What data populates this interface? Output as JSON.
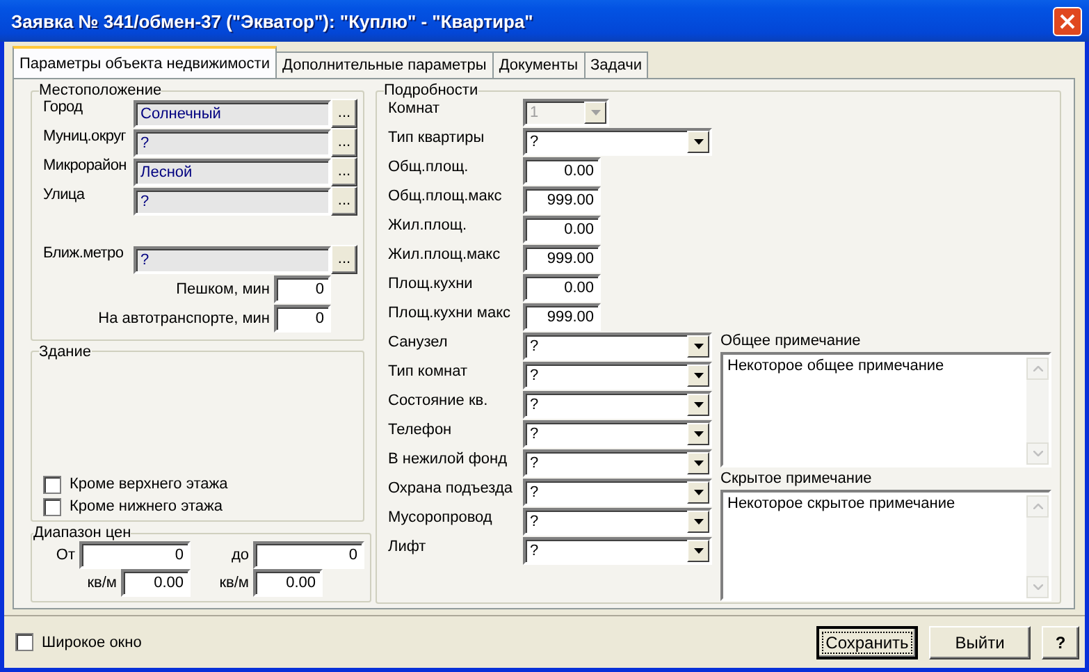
{
  "window": {
    "title": "Заявка № 341/обмен-37 (\"Экватор\"): \"Куплю\" - \"Квартира\""
  },
  "tabs": [
    {
      "label": "Параметры объекта недвижимости",
      "selected": true
    },
    {
      "label": "Дополнительные параметры",
      "selected": false
    },
    {
      "label": "Документы",
      "selected": false
    },
    {
      "label": "Задачи",
      "selected": false
    }
  ],
  "location": {
    "title": "Местоположение",
    "fields": [
      {
        "label": "Город",
        "value": "Солнечный"
      },
      {
        "label": "Муниц.округ",
        "value": "?"
      },
      {
        "label": "Микрорайон",
        "value": "Лесной"
      },
      {
        "label": "Улица",
        "value": "?"
      },
      {
        "label": "Ближ.метро",
        "value": "?"
      }
    ],
    "browse_label": "...",
    "times": [
      {
        "label": "Пешком, мин",
        "value": "0"
      },
      {
        "label": "На автотранспорте, мин",
        "value": "0"
      }
    ]
  },
  "building": {
    "title": "Здание",
    "checkboxes": [
      {
        "label": "Кроме верхнего этажа",
        "checked": false
      },
      {
        "label": "Кроме нижнего этажа",
        "checked": false
      }
    ]
  },
  "price_range": {
    "title": "Диапазон цен",
    "rows": [
      [
        {
          "label": "От",
          "value": "0"
        },
        {
          "label": "до",
          "value": "0"
        }
      ],
      [
        {
          "label": "кв/м",
          "value": "0.00"
        },
        {
          "label": "кв/м",
          "value": "0.00"
        }
      ]
    ]
  },
  "details": {
    "title": "Подробности",
    "fields": [
      {
        "label": "Комнат",
        "kind": "short_combo",
        "value": "1",
        "disabled": true
      },
      {
        "label": "Тип квартиры",
        "kind": "combo",
        "value": "?",
        "disabled": false
      },
      {
        "label": "Общ.площ.",
        "kind": "number",
        "value": "0.00",
        "disabled": false
      },
      {
        "label": "Общ.площ.макс",
        "kind": "number",
        "value": "999.00",
        "disabled": false
      },
      {
        "label": "Жил.площ.",
        "kind": "number",
        "value": "0.00",
        "disabled": false
      },
      {
        "label": "Жил.площ.макс",
        "kind": "number",
        "value": "999.00",
        "disabled": false
      },
      {
        "label": "Площ.кухни",
        "kind": "number",
        "value": "0.00",
        "disabled": false
      },
      {
        "label": "Площ.кухни макс",
        "kind": "number",
        "value": "999.00",
        "disabled": false
      },
      {
        "label": "Санузел",
        "kind": "combo",
        "value": "?",
        "disabled": false
      },
      {
        "label": "Тип комнат",
        "kind": "combo",
        "value": "?",
        "disabled": false
      },
      {
        "label": "Состояние кв.",
        "kind": "combo",
        "value": "?",
        "disabled": false
      },
      {
        "label": "Телефон",
        "kind": "combo",
        "value": "?",
        "disabled": false
      },
      {
        "label": "В нежилой фонд",
        "kind": "combo",
        "value": "?",
        "disabled": false
      },
      {
        "label": "Охрана подъезда",
        "kind": "combo",
        "value": "?",
        "disabled": false
      },
      {
        "label": "Мусоропровод",
        "kind": "combo",
        "value": "?",
        "disabled": false
      },
      {
        "label": "Лифт",
        "kind": "combo",
        "value": "?",
        "disabled": false
      }
    ],
    "notes": [
      {
        "label": "Общее примечание",
        "value": "Некоторое общее примечание"
      },
      {
        "label": "Скрытое примечание",
        "value": "Некоторое скрытое примечание"
      }
    ]
  },
  "wide_window": {
    "label": "Широкое окно",
    "checked": false
  },
  "buttons": [
    {
      "label": "Сохранить",
      "focused": true
    },
    {
      "label": "Выйти",
      "focused": false
    },
    {
      "label": "?",
      "focused": false
    }
  ]
}
